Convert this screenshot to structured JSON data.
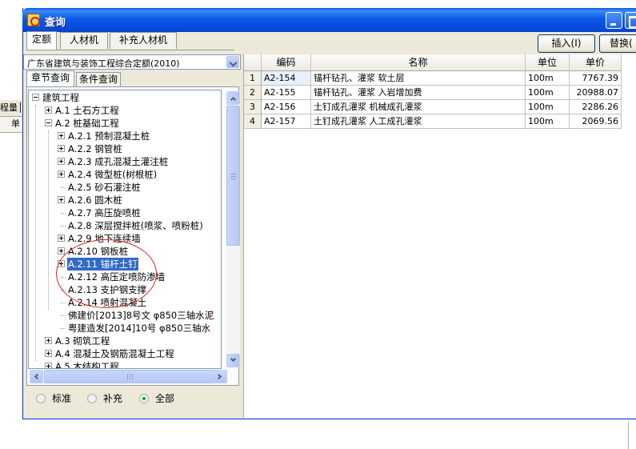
{
  "window": {
    "title": "查询",
    "top_tabs": [
      "定额",
      "人材机",
      "补充人材机"
    ],
    "buttons": {
      "insert": "插入(I)",
      "replace": "替换("
    }
  },
  "background_app": {
    "toolbar_text": "程量│",
    "column_text": "单"
  },
  "left_panel": {
    "quota_library": "广东省建筑与装饰工程综合定额(2010)",
    "search_tabs": [
      "章节查询",
      "条件查询"
    ],
    "tree": [
      {
        "label": "建筑工程",
        "level": 0,
        "toggle": "minus"
      },
      {
        "label": "A.1 土石方工程",
        "level": 1,
        "toggle": "plus"
      },
      {
        "label": "A.2 桩基础工程",
        "level": 1,
        "toggle": "minus"
      },
      {
        "label": "A.2.1 预制混凝土桩",
        "level": 2,
        "toggle": "plus"
      },
      {
        "label": "A.2.2 钢管桩",
        "level": 2,
        "toggle": "plus"
      },
      {
        "label": "A.2.3 成孔混凝土灌注桩",
        "level": 2,
        "toggle": "plus"
      },
      {
        "label": "A.2.4 微型桩(树根桩)",
        "level": 2,
        "toggle": "plus"
      },
      {
        "label": "A.2.5 砂石灌注桩",
        "level": 2,
        "toggle": "none"
      },
      {
        "label": "A.2.6 圆木桩",
        "level": 2,
        "toggle": "plus"
      },
      {
        "label": "A.2.7 高压旋喷桩",
        "level": 2,
        "toggle": "none"
      },
      {
        "label": "A.2.8 深层搅拌桩(喷浆、喷粉桩)",
        "level": 2,
        "toggle": "none"
      },
      {
        "label": "A.2.9 地下连续墙",
        "level": 2,
        "toggle": "plus"
      },
      {
        "label": "A.2.10 钢板桩",
        "level": 2,
        "toggle": "plus"
      },
      {
        "label": "A.2.11 锚杆土钉",
        "level": 2,
        "toggle": "plus",
        "selected": true
      },
      {
        "label": "A.2.12 高压定喷防渗墙",
        "level": 2,
        "toggle": "none"
      },
      {
        "label": "A.2.13 支护钢支撑",
        "level": 2,
        "toggle": "none"
      },
      {
        "label": "A.2.14 喷射混凝土",
        "level": 2,
        "toggle": "none"
      },
      {
        "label": "佛建价[2013]8号文 φ850三轴水泥",
        "level": 2,
        "toggle": "none"
      },
      {
        "label": "粤建造发[2014]10号 φ850三轴水",
        "level": 2,
        "toggle": "none"
      },
      {
        "label": "A.3 砌筑工程",
        "level": 1,
        "toggle": "plus"
      },
      {
        "label": "A.4 混凝土及钢筋混凝土工程",
        "level": 1,
        "toggle": "plus"
      },
      {
        "label": "A.5 木结构工程",
        "level": 1,
        "toggle": "plus"
      }
    ],
    "filters": [
      "标准",
      "补充",
      "全部"
    ],
    "filter_selected": "全部"
  },
  "grid": {
    "columns": [
      "编码",
      "名称",
      "单位",
      "单价"
    ],
    "rows": [
      {
        "index": "1",
        "code": "A2-154",
        "name": "锚杆钻孔、灌浆 软土层",
        "unit": "100m",
        "price": "7767.39"
      },
      {
        "index": "2",
        "code": "A2-155",
        "name": "锚杆钻孔、灌浆 入岩增加费",
        "unit": "100m",
        "price": "20988.07"
      },
      {
        "index": "3",
        "code": "A2-156",
        "name": "土钉成孔灌浆 机械成孔灌浆",
        "unit": "100m",
        "price": "2286.26"
      },
      {
        "index": "4",
        "code": "A2-157",
        "name": "土钉成孔灌浆 人工成孔灌浆",
        "unit": "100m",
        "price": "2069.56"
      }
    ]
  },
  "colors": {
    "titlebar": "#0a5ae8",
    "selection": "#316ac5",
    "annotation_circle": "#e02020",
    "chrome": "#ece9d8"
  }
}
